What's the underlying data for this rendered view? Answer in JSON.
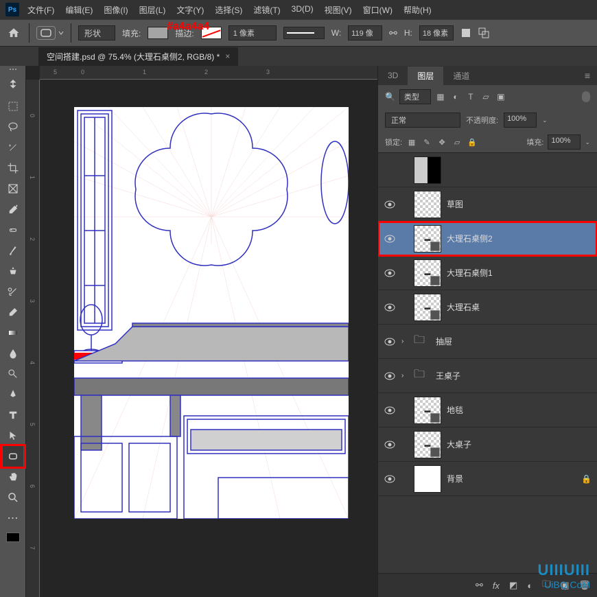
{
  "menus": [
    "文件(F)",
    "编辑(E)",
    "图像(I)",
    "图层(L)",
    "文字(Y)",
    "选择(S)",
    "滤镜(T)",
    "3D(D)",
    "视图(V)",
    "窗口(W)",
    "帮助(H)"
  ],
  "color_annotation": "#a4a4a4",
  "options": {
    "shape_mode": "形状",
    "fill_label": "填充:",
    "stroke_label": "描边:",
    "stroke_width": "1 像素",
    "width_label": "W:",
    "width_value": "119 像",
    "height_label": "H:",
    "height_value": "18 像素"
  },
  "doc_tab": "空间搭建.psd @ 75.4% (大理石桌侧2, RGB/8) *",
  "ruler_h": [
    "5",
    "0",
    "1",
    "2",
    "3"
  ],
  "ruler_h_neg": "-",
  "ruler_v": [
    "0",
    "1",
    "2",
    "3",
    "4",
    "5",
    "6",
    "7"
  ],
  "panel_tabs": {
    "threeD": "3D",
    "layers": "图层",
    "channels": "通道"
  },
  "layer_panel": {
    "filter_type": "类型",
    "blend_mode": "正常",
    "opacity_label": "不透明度:",
    "opacity_value": "100%",
    "lock_label": "锁定:",
    "fill_label": "填充:",
    "fill_value": "100%"
  },
  "layers": [
    {
      "name": "",
      "visible": false,
      "thumb": "white-black"
    },
    {
      "name": "草图",
      "visible": true,
      "thumb": "checker"
    },
    {
      "name": "大理石桌侧2",
      "visible": true,
      "thumb": "shape",
      "selected": true,
      "highlighted": true
    },
    {
      "name": "大理石桌侧1",
      "visible": true,
      "thumb": "shape"
    },
    {
      "name": "大理石桌",
      "visible": true,
      "thumb": "shape"
    },
    {
      "name": "抽屉",
      "visible": true,
      "folder": true
    },
    {
      "name": "王桌子",
      "visible": true,
      "folder": true
    },
    {
      "name": "地毯",
      "visible": true,
      "thumb": "shape"
    },
    {
      "name": "大桌子",
      "visible": true,
      "thumb": "shape"
    },
    {
      "name": "背景",
      "visible": true,
      "thumb": "white",
      "locked": true
    }
  ],
  "watermark": {
    "main": "UIIIUIII",
    "sub": "UiBQ.CoM"
  }
}
